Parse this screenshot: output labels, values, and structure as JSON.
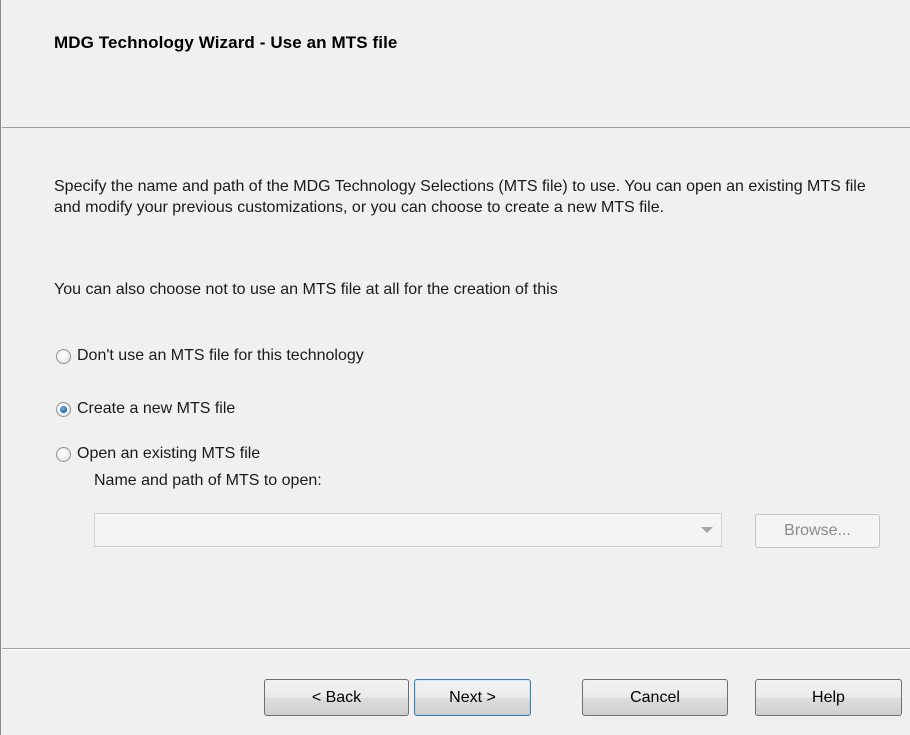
{
  "window": {
    "title": "MDG Technology Wizard - Use an MTS file"
  },
  "body": {
    "paragraph1": "Specify the name and path of the MDG Technology Selections (MTS file) to use. You can open an existing MTS file and modify your previous customizations, or you can choose to create a new MTS file.",
    "paragraph2": "You can also choose not to use an MTS file at all for the creation of this"
  },
  "options": [
    {
      "label": "Don't use an MTS file for this technology",
      "selected": false
    },
    {
      "label": "Create a new MTS file",
      "selected": true
    },
    {
      "label": "Open an existing MTS file",
      "selected": false
    }
  ],
  "mts_path": {
    "label": "Name and path of MTS to open:",
    "value": "",
    "enabled": false
  },
  "browse_label": "Browse...",
  "footer": {
    "back_label": "< Back",
    "next_label": "Next >",
    "cancel_label": "Cancel",
    "help_label": "Help"
  },
  "colors": {
    "dialog_bg": "#f0f0f0",
    "radio_selected": "#2a6cb5",
    "default_button_border": "#3c7fb1",
    "disabled_text": "#8a8a8a"
  }
}
